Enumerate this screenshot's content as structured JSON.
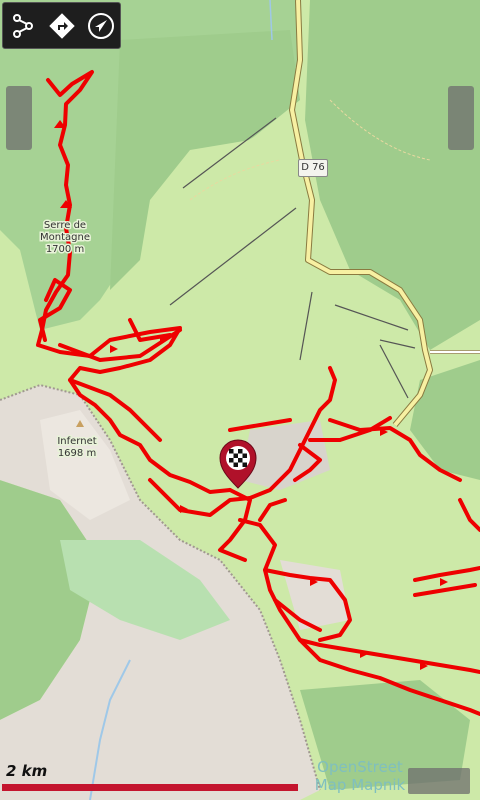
{
  "map": {
    "colors": {
      "forest": "#9fcc8c",
      "meadow": "#cde9a8",
      "rock": "#e3ddd6",
      "track": "#ee0000",
      "road": "#f7f0a2",
      "lift": "#555555"
    },
    "places": [
      {
        "name": "Serre de",
        "id": "serre-de-montagne-label-1"
      },
      {
        "name": "Montagne",
        "id": "serre-de-montagne-label-2"
      },
      {
        "name": "1700 m",
        "id": "serre-de-montagne-elevation"
      },
      {
        "name": "Infernet",
        "id": "infernet-label"
      },
      {
        "name": "1698 m",
        "id": "infernet-elevation"
      }
    ],
    "road_label": "D 76"
  },
  "toolbar": {
    "buttons": [
      {
        "icon": "route-nodes-icon"
      },
      {
        "icon": "directions-icon"
      },
      {
        "icon": "navigation-arrow-icon"
      }
    ]
  },
  "scale": {
    "label": "2 km"
  },
  "attribution": {
    "line1": "OpenStreet",
    "line2": "Map Mapnik"
  },
  "marker": {
    "icon": "finish-flag-marker-icon"
  }
}
